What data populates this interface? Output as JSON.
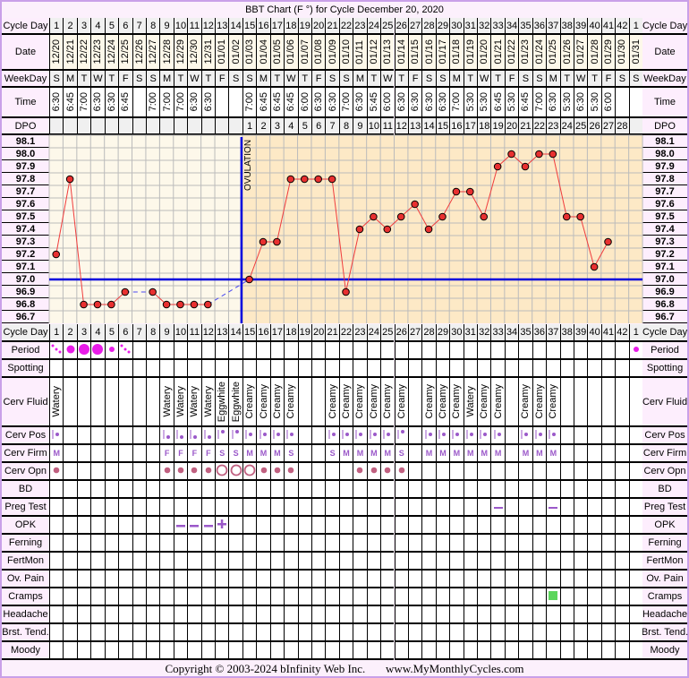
{
  "title": "BBT Chart (F °) for Cycle December 20, 2020",
  "footer": {
    "copyright": "Copyright © 2003-2024 bInfinity Web Inc.",
    "site": "www.MyMonthlyCycles.com"
  },
  "row_labels": {
    "cycle_day": "Cycle Day",
    "date": "Date",
    "weekday": "WeekDay",
    "time": "Time",
    "dpo": "DPO",
    "period": "Period",
    "spotting": "Spotting",
    "cerv_fluid": "Cerv Fluid",
    "cerv_pos": "Cerv Pos",
    "cerv_firm": "Cerv Firm",
    "cerv_opn": "Cerv Opn",
    "bd": "BD",
    "preg_test": "Preg Test",
    "opk": "OPK",
    "ferning": "Ferning",
    "fertmon": "FertMon",
    "ov_pain": "Ov. Pain",
    "cramps": "Cramps",
    "headache": "Headache",
    "brst_tend": "Brst. Tend.",
    "moody": "Moody"
  },
  "colors": {
    "temp_line": "#f03c3c",
    "coverline": "#0000dd",
    "follicular_bg": "#fdf8ea",
    "luteal_bg": "#fde9c6",
    "period": "#e81ce8",
    "marker": "#9b59c9",
    "opn": "#c06080",
    "cramps": "#5cd65c"
  },
  "chart_data": {
    "type": "line",
    "title": "BBT Chart (F °) for Cycle December 20, 2020",
    "xlabel": "Cycle Day",
    "ylabel": "Temperature (F)",
    "ylim": [
      96.7,
      98.1
    ],
    "yticks": [
      "98.1",
      "98.0",
      "97.9",
      "97.8",
      "97.7",
      "97.6",
      "97.5",
      "97.4",
      "97.3",
      "97.2",
      "97.1",
      "97.0",
      "96.9",
      "96.8",
      "96.7"
    ],
    "cycle_days": [
      "1",
      "2",
      "3",
      "4",
      "5",
      "6",
      "7",
      "8",
      "9",
      "10",
      "11",
      "12",
      "13",
      "14",
      "15",
      "16",
      "17",
      "18",
      "19",
      "20",
      "21",
      "22",
      "23",
      "24",
      "25",
      "26",
      "27",
      "28",
      "29",
      "30",
      "31",
      "32",
      "33",
      "34",
      "35",
      "36",
      "37",
      "38",
      "39",
      "40",
      "41",
      "42",
      "1"
    ],
    "dates": [
      "12/20",
      "12/21",
      "12/22",
      "12/23",
      "12/24",
      "12/25",
      "12/26",
      "12/27",
      "12/28",
      "12/29",
      "12/30",
      "12/31",
      "01/01",
      "01/02",
      "01/03",
      "01/04",
      "01/05",
      "01/06",
      "01/07",
      "01/08",
      "01/09",
      "01/10",
      "01/11",
      "01/12",
      "01/13",
      "01/14",
      "01/15",
      "01/16",
      "01/17",
      "01/18",
      "01/19",
      "01/20",
      "01/21",
      "01/22",
      "01/23",
      "01/24",
      "01/25",
      "01/26",
      "01/27",
      "01/28",
      "01/29",
      "01/30",
      "01/31"
    ],
    "weekdays": [
      "S",
      "M",
      "T",
      "W",
      "T",
      "F",
      "S",
      "S",
      "M",
      "T",
      "W",
      "T",
      "F",
      "S",
      "S",
      "M",
      "T",
      "W",
      "T",
      "F",
      "S",
      "S",
      "M",
      "T",
      "W",
      "T",
      "F",
      "S",
      "S",
      "M",
      "T",
      "W",
      "T",
      "F",
      "S",
      "S",
      "M",
      "T",
      "W",
      "T",
      "F",
      "S",
      "S"
    ],
    "times": [
      "6:30",
      "6:45",
      "7:00",
      "6:30",
      "6:30",
      "6:45",
      "",
      "7:00",
      "7:00",
      "7:00",
      "6:30",
      "6:30",
      "",
      "",
      "7:00",
      "6:45",
      "6:45",
      "6:45",
      "6:00",
      "6:30",
      "6:30",
      "7:00",
      "6:30",
      "5:45",
      "6:00",
      "6:30",
      "6:30",
      "6:30",
      "6:30",
      "7:00",
      "5:30",
      "5:30",
      "6:45",
      "5:30",
      "6:45",
      "7:00",
      "6:30",
      "5:30",
      "6:30",
      "5:30",
      "6:00",
      "",
      ""
    ],
    "dpo": [
      "",
      "",
      "",
      "",
      "",
      "",
      "",
      "",
      "",
      "",
      "",
      "",
      "",
      "",
      "1",
      "2",
      "3",
      "4",
      "5",
      "6",
      "7",
      "8",
      "9",
      "10",
      "11",
      "12",
      "13",
      "14",
      "15",
      "16",
      "17",
      "18",
      "19",
      "20",
      "21",
      "22",
      "23",
      "24",
      "25",
      "26",
      "27",
      "28",
      ""
    ],
    "series": [
      {
        "name": "BBT",
        "values": [
          97.2,
          97.8,
          96.8,
          96.8,
          96.8,
          96.9,
          null,
          96.9,
          96.8,
          96.8,
          96.8,
          96.8,
          null,
          null,
          97.0,
          97.3,
          97.3,
          97.8,
          97.8,
          97.8,
          97.8,
          96.9,
          97.4,
          97.5,
          97.4,
          97.5,
          97.6,
          97.4,
          97.5,
          97.7,
          97.7,
          97.5,
          97.9,
          98.0,
          97.9,
          98.0,
          98.0,
          97.5,
          97.5,
          97.1,
          97.3,
          null,
          null
        ]
      }
    ],
    "coverline": 97.0,
    "ovulation_day": 14,
    "ovulation_label": "OVULATION",
    "period": [
      "spot",
      "medium",
      "heavy",
      "heavy",
      "light",
      "spot",
      "",
      "",
      "",
      "",
      "",
      "",
      "",
      "",
      "",
      "",
      "",
      "",
      "",
      "",
      "",
      "",
      "",
      "",
      "",
      "",
      "",
      "",
      "",
      "",
      "",
      "",
      "",
      "",
      "",
      "",
      "",
      "",
      "",
      "",
      "",
      "",
      "light"
    ],
    "cerv_fluid": [
      "Watery",
      "",
      "",
      "",
      "",
      "",
      "",
      "",
      "Watery",
      "Watery",
      "Watery",
      "Watery",
      "Eggwhite",
      "Eggwhite",
      "Creamy",
      "Creamy",
      "Creamy",
      "Creamy",
      "",
      "",
      "Creamy",
      "Creamy",
      "Creamy",
      "Creamy",
      "Creamy",
      "Creamy",
      "",
      "Creamy",
      "Creamy",
      "Creamy",
      "Watery",
      "Creamy",
      "Creamy",
      "",
      "Creamy",
      "Creamy",
      "Creamy",
      "",
      "",
      "",
      "",
      "",
      ""
    ],
    "cerv_pos": [
      "mid",
      "",
      "",
      "",
      "",
      "",
      "",
      "",
      "low",
      "low",
      "low",
      "low",
      "high",
      "high",
      "mid",
      "mid",
      "mid",
      "mid",
      "",
      "",
      "mid",
      "mid",
      "mid",
      "mid",
      "mid",
      "high",
      "",
      "mid",
      "mid",
      "mid",
      "mid",
      "mid",
      "mid",
      "",
      "mid",
      "mid",
      "mid",
      "",
      "",
      "",
      "",
      "",
      ""
    ],
    "cerv_firm": [
      "M",
      "",
      "",
      "",
      "",
      "",
      "",
      "",
      "F",
      "F",
      "F",
      "F",
      "S",
      "S",
      "M",
      "M",
      "M",
      "S",
      "",
      "",
      "S",
      "M",
      "M",
      "M",
      "M",
      "S",
      "",
      "M",
      "M",
      "M",
      "M",
      "M",
      "M",
      "",
      "M",
      "M",
      "M",
      "",
      "",
      "",
      "",
      "",
      ""
    ],
    "cerv_opn": [
      "closed",
      "",
      "",
      "",
      "",
      "",
      "",
      "",
      "closed",
      "closed",
      "closed",
      "closed",
      "open",
      "open",
      "open",
      "closed",
      "closed",
      "closed",
      "",
      "",
      "",
      "",
      "closed",
      "closed",
      "closed",
      "closed",
      "",
      "",
      "",
      "",
      "",
      "",
      "",
      "",
      "",
      "",
      "",
      "",
      "",
      "",
      "",
      "",
      ""
    ],
    "preg_test": {
      "33": "negative",
      "37": "negative"
    },
    "opk": {
      "10": "negative",
      "11": "negative",
      "12": "negative",
      "13": "positive"
    },
    "cramps": [
      37
    ]
  }
}
